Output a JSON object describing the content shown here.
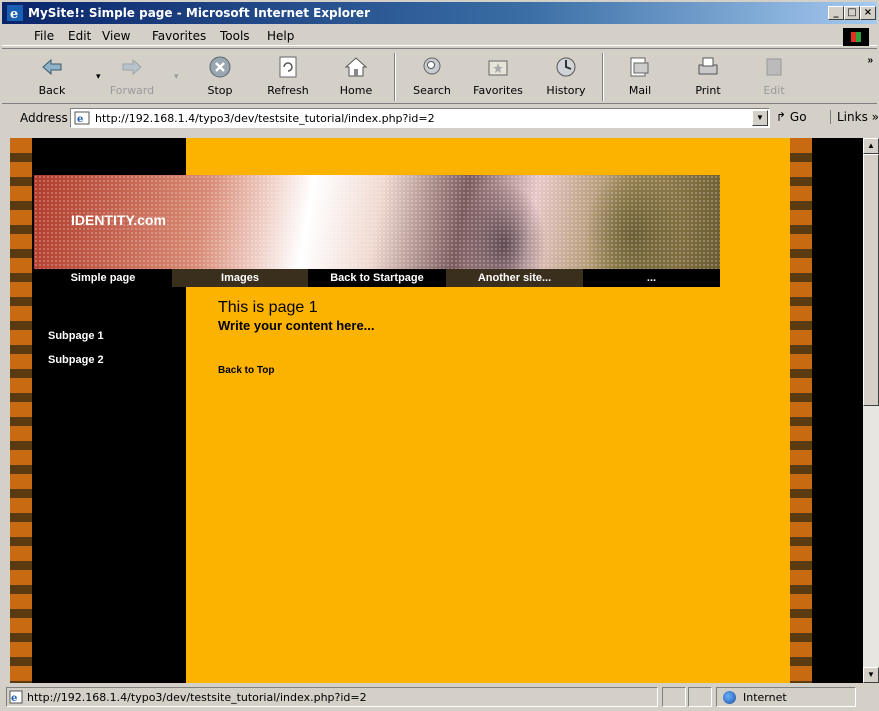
{
  "window": {
    "title": "MySite!: Simple page - Microsoft Internet Explorer",
    "controls": {
      "minimize": "_",
      "maximize": "□",
      "close": "×"
    }
  },
  "menu": {
    "items": [
      {
        "label": "File"
      },
      {
        "label": "Edit"
      },
      {
        "label": "View"
      },
      {
        "label": "Favorites"
      },
      {
        "label": "Tools"
      },
      {
        "label": "Help"
      }
    ]
  },
  "toolbar": {
    "buttons": [
      {
        "label": "Back",
        "icon": "back-arrow-icon",
        "enabled": true
      },
      {
        "label": "Forward",
        "icon": "forward-arrow-icon",
        "enabled": false
      },
      {
        "label": "Stop",
        "icon": "stop-icon",
        "enabled": true
      },
      {
        "label": "Refresh",
        "icon": "refresh-icon",
        "enabled": true
      },
      {
        "label": "Home",
        "icon": "home-icon",
        "enabled": true
      },
      {
        "label": "Search",
        "icon": "search-icon",
        "enabled": true
      },
      {
        "label": "Favorites",
        "icon": "favorites-icon",
        "enabled": true
      },
      {
        "label": "History",
        "icon": "history-icon",
        "enabled": true
      },
      {
        "label": "Mail",
        "icon": "mail-icon",
        "enabled": true
      },
      {
        "label": "Print",
        "icon": "print-icon",
        "enabled": true
      },
      {
        "label": "Edit",
        "icon": "edit-icon",
        "enabled": false
      }
    ],
    "overflow": "»"
  },
  "address": {
    "label": "Address",
    "url": "http://192.168.1.4/typo3/dev/testsite_tutorial/index.php?id=2",
    "go_label": "Go",
    "links_label": "Links",
    "links_chevron": "»"
  },
  "page": {
    "logo": "IDENTITY.com",
    "nav": [
      {
        "label": "Simple page"
      },
      {
        "label": "Images"
      },
      {
        "label": "Back to Startpage"
      },
      {
        "label": "Another site..."
      },
      {
        "label": "..."
      }
    ],
    "side_links": [
      {
        "label": "Subpage 1"
      },
      {
        "label": "Subpage 2"
      }
    ],
    "title": "This is page 1",
    "subtitle": "Write your content here...",
    "back_to_top": "Back to Top",
    "colors": {
      "content_bg": "#fbb300",
      "sidebar_bg": "#000000",
      "film_orange": "#c86a12"
    }
  },
  "status": {
    "text": "http://192.168.1.4/typo3/dev/testsite_tutorial/index.php?id=2",
    "zone": "Internet"
  }
}
